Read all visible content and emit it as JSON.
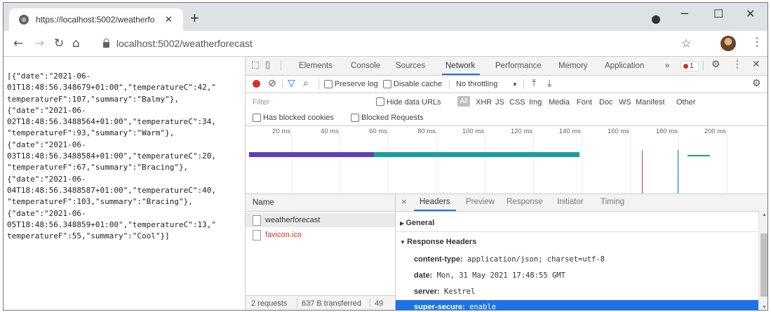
{
  "browser": {
    "tab_title": "https://localhost:5002/weatherfo",
    "tab_close": "✕",
    "new_tab": "+",
    "url": "localhost:5002/weatherforecast",
    "window_controls": {
      "minimize": "─",
      "maximize": "☐",
      "close": "✕"
    }
  },
  "page": {
    "json_lines": [
      "[{\"date\":\"2021-06-",
      "01T18:48:56.348679+01:00\",\"temperatureC\":42,\"",
      "temperatureF\":107,\"summary\":\"Balmy\"},",
      "{\"date\":\"2021-06-",
      "02T18:48:56.3488564+01:00\",\"temperatureC\":34,",
      "\"temperatureF\":93,\"summary\":\"Warm\"},",
      "{\"date\":\"2021-06-",
      "03T18:48:56.3488584+01:00\",\"temperatureC\":20,",
      "\"temperatureF\":67,\"summary\":\"Bracing\"},",
      "{\"date\":\"2021-06-",
      "04T18:48:56.3488587+01:00\",\"temperatureC\":40,",
      "\"temperatureF\":103,\"summary\":\"Bracing\"},",
      "{\"date\":\"2021-06-",
      "05T18:48:56.348859+01:00\",\"temperatureC\":13,\"",
      "temperatureF\":55,\"summary\":\"Cool\"}]"
    ]
  },
  "devtools": {
    "tabs": [
      "Elements",
      "Console",
      "Sources",
      "Network",
      "Performance",
      "Memory",
      "Application"
    ],
    "active_tab": "Network",
    "more": "»",
    "error_count": "1",
    "toolbar": {
      "preserve_log": "Preserve log",
      "disable_cache": "Disable cache",
      "throttling": "No throttling"
    },
    "filter": {
      "placeholder": "Filter",
      "hide_data_urls": "Hide data URLs",
      "all": "All",
      "types": [
        "XHR",
        "JS",
        "CSS",
        "Img",
        "Media",
        "Font",
        "Doc",
        "WS",
        "Manifest",
        "Other"
      ],
      "has_blocked_cookies": "Has blocked cookies",
      "blocked_requests": "Blocked Requests"
    },
    "timeline": {
      "ticks": [
        "20 ms",
        "40 ms",
        "60 ms",
        "80 ms",
        "100 ms",
        "120 ms",
        "140 ms",
        "160 ms",
        "180 ms",
        "200 ms"
      ],
      "colors": {
        "purple": "#5b3fbf",
        "teal": "#19a09a",
        "red": "#b3473a",
        "blue": "#1a73e8",
        "green": "#1aaf54"
      }
    },
    "requests": {
      "header": "Name",
      "rows": [
        {
          "name": "weatherforecast",
          "color": "#333333"
        },
        {
          "name": "favicon.ico",
          "color": "#d93025"
        }
      ],
      "summary": {
        "count": "2 requests",
        "transferred": "637 B transferred",
        "more": "49"
      }
    },
    "details": {
      "close": "×",
      "tabs": [
        "Headers",
        "Preview",
        "Response",
        "Initiator",
        "Timing"
      ],
      "active_tab": "Headers",
      "general": "General",
      "response_headers_title": "Response Headers",
      "response_headers": [
        {
          "key": "content-type:",
          "value": "application/json; charset=utf-8"
        },
        {
          "key": "date:",
          "value": "Mon, 31 May 2021 17:48:55 GMT"
        },
        {
          "key": "server:",
          "value": "Kestrel"
        },
        {
          "key": "super-secure:",
          "value": "enable"
        }
      ]
    }
  }
}
